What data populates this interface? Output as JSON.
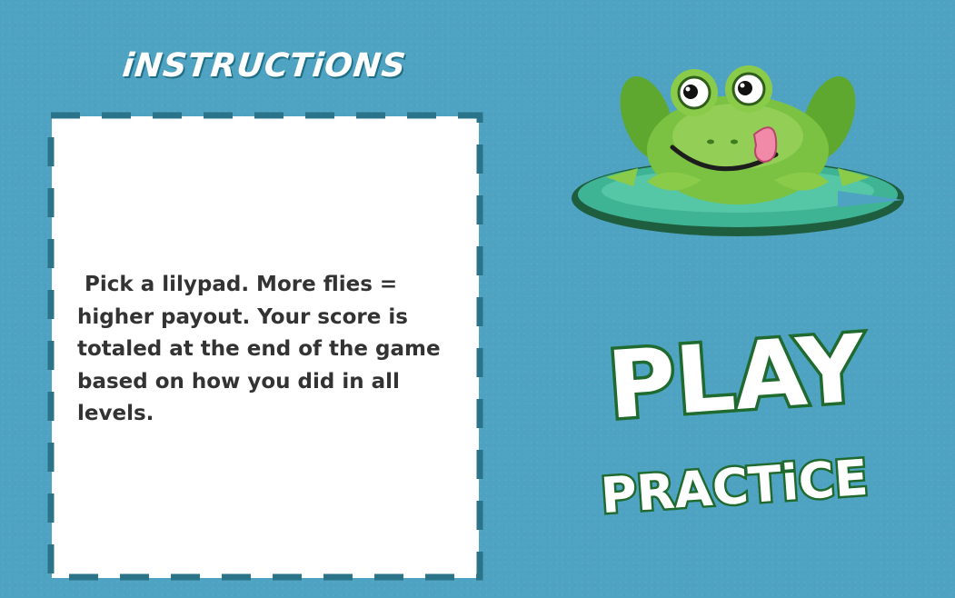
{
  "header": {
    "title": "iNSTRUCTiONS"
  },
  "instructions": {
    "text": " Pick a lilypad. More flies =\nhigher payout. Your score is\ntotaled at the end of the game\nbased on how you did in all\nlevels."
  },
  "buttons": {
    "play_label": "PLAY",
    "practice_label": "PRACTiCE"
  },
  "colors": {
    "background": "#4fa3c2",
    "card_border": "#2a7389",
    "button_fill": "#ffffff",
    "button_outline": "#1f6a2e",
    "frog_green": "#7cc242",
    "lilypad": "#3fb494"
  },
  "icons": {
    "mascot": "frog-on-lilypad-icon"
  }
}
